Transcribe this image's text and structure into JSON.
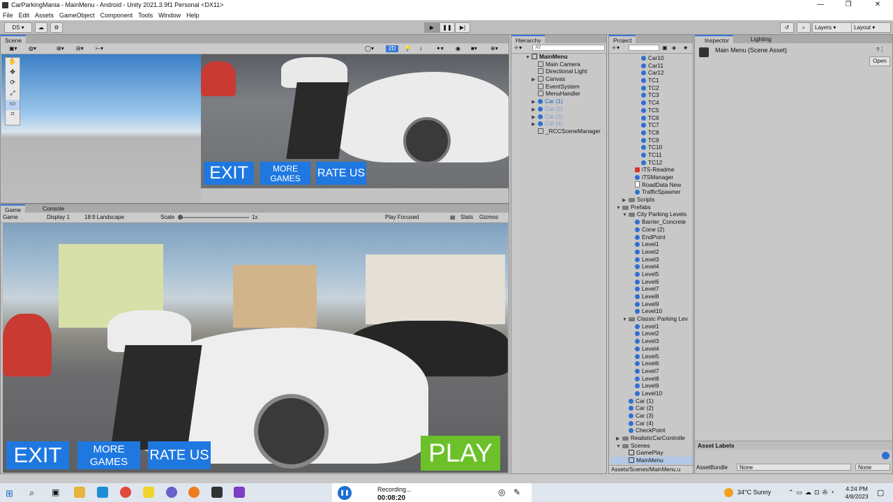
{
  "window": {
    "title": "CarParkingMania - MainMenu - Android - Unity 2021.3.9f1 Personal <DX11>"
  },
  "menu": [
    "File",
    "Edit",
    "Assets",
    "GameObject",
    "Component",
    "Tools",
    "Window",
    "Help"
  ],
  "toolbar": {
    "account": "DS",
    "layers": "Layers",
    "layout": "Layout"
  },
  "scene_panel": {
    "tab": "Scene",
    "mode_2d": "2D"
  },
  "game_panel": {
    "tabs": [
      "Game",
      "Console"
    ],
    "mode": "Game",
    "display": "Display 1",
    "resolution": "18:9 Landscape",
    "scale_label": "Scale",
    "scale_value": "1x",
    "play_mode": "Play Focused",
    "stats": "Stats",
    "gizmos": "Gizmos"
  },
  "game_ui": {
    "exit": "EXIT",
    "more_games": "MORE GAMES",
    "rate_us": "RATE US",
    "play": "PLAY"
  },
  "hierarchy": {
    "tab": "Hierarchy",
    "search_placeholder": "All",
    "scene": "MainMenu",
    "items": [
      "Main Camera",
      "Directional Light",
      "Canvas",
      "EventSystem",
      "MenuHandler",
      "Car (1)",
      "Car (2)",
      "Car (3)",
      "Car (4)",
      "_RCCSceneManager"
    ]
  },
  "project": {
    "tab": "Project",
    "items": [
      "Car10",
      "Car11",
      "Car12",
      "TC1",
      "TC2",
      "TC3",
      "TC4",
      "TC5",
      "TC6",
      "TC7",
      "TC8",
      "TC9",
      "TC10",
      "TC11",
      "TC12",
      "iTS-Readme",
      "iTSManager",
      "RoadData New",
      "TrafficSpawner",
      "Scripts",
      "Prefabs",
      "City Parking Levels",
      "Barrier_Concrete",
      "Cone (2)",
      "EndPoint",
      "Level1",
      "Level2",
      "Level3",
      "Level4",
      "Level5",
      "Level6",
      "Level7",
      "Level8",
      "Level9",
      "Level10",
      "Classic Parking Lev",
      "Level1",
      "Level2",
      "Level3",
      "Level4",
      "Level5",
      "Level6",
      "Level7",
      "Level8",
      "Level9",
      "Level10",
      "Car (1)",
      "Car (2)",
      "Car (3)",
      "Car (4)",
      "CheckPoint",
      "RealisticCarControlle",
      "Scenes",
      "GamePlay",
      "MainMenu"
    ],
    "path": "Assets/Scenes/MainMenu.u"
  },
  "inspector": {
    "tabs": [
      "Inspector",
      "Lighting"
    ],
    "title": "Main Menu (Scene Asset)",
    "open_button": "Open",
    "asset_labels": "Asset Labels",
    "asset_bundle": "AssetBundle",
    "bundle_value": "None",
    "variant_value": "None"
  },
  "taskbar": {
    "recording": "Recording...",
    "timer": "00:08:20",
    "weather": "34°C  Sunny",
    "time": "4:24 PM",
    "date": "4/8/2023"
  },
  "colors": {
    "accent": "#3a79d9",
    "ui_blue": "#1f78e0",
    "play_green": "#6cc12a",
    "selection": "#3d7ad6"
  }
}
